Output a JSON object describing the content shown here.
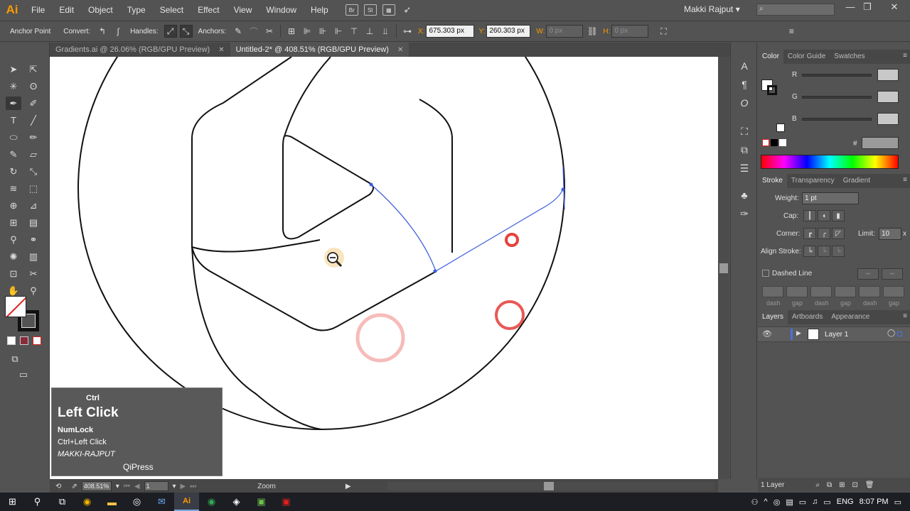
{
  "app": {
    "logo": "Ai",
    "user": "Makki Rajput",
    "user_chevron": "▾"
  },
  "menu": [
    "File",
    "Edit",
    "Object",
    "Type",
    "Select",
    "Effect",
    "View",
    "Window",
    "Help"
  ],
  "menubar_icons": {
    "bridge": "Br",
    "stock": "St"
  },
  "window_controls": {
    "minimize": "—",
    "restore": "❐",
    "close": "✕"
  },
  "controlbar": {
    "tool_name": "Anchor Point",
    "convert_label": "Convert:",
    "handles_label": "Handles:",
    "anchors_label": "Anchors:",
    "x_label": "X:",
    "x_value": "675.303 px",
    "y_label": "Y:",
    "y_value": "260.303 px",
    "w_label": "W:",
    "w_value": "0 px",
    "h_label": "H:",
    "h_value": "0 px"
  },
  "tabs": [
    {
      "label": "Gradients.ai @ 26.06% (RGB/GPU Preview)",
      "close": "✕"
    },
    {
      "label": "Untitled-2* @ 408.51% (RGB/GPU Preview)",
      "close": "✕"
    }
  ],
  "statusbar": {
    "zoom": "408.51%",
    "artboard": "1",
    "tool": "Zoom"
  },
  "key_overlay": {
    "modifier": "Ctrl",
    "action": "Left Click",
    "line1": "NumLock",
    "line2": "Ctrl+Left Click",
    "line3": "MAKKI-RAJPUT",
    "brand": "QiPress"
  },
  "color_panel": {
    "tabs": [
      "Color",
      "Color Guide",
      "Swatches"
    ],
    "r_label": "R",
    "g_label": "G",
    "b_label": "B",
    "hash": "#"
  },
  "stroke_panel": {
    "tabs": [
      "Stroke",
      "Transparency",
      "Gradient"
    ],
    "weight_label": "Weight:",
    "weight_value": "1 pt",
    "cap_label": "Cap:",
    "corner_label": "Corner:",
    "limit_label": "Limit:",
    "limit_value": "10",
    "limit_unit": "x",
    "align_label": "Align Stroke:",
    "dashed_label": "Dashed Line",
    "dash_labels": [
      "dash",
      "gap",
      "dash",
      "gap",
      "dash",
      "gap"
    ]
  },
  "layers_panel": {
    "tabs": [
      "Layers",
      "Artboards",
      "Appearance"
    ],
    "layer_name": "Layer 1",
    "layer_count": "1 Layer"
  },
  "taskbar": {
    "lang": "ENG",
    "time": "8:07 PM"
  },
  "colors": {
    "accent": "#ff9a00",
    "ui_bg": "#535353",
    "path_select": "#3b5bdb",
    "click_ring": "#e0201c"
  }
}
